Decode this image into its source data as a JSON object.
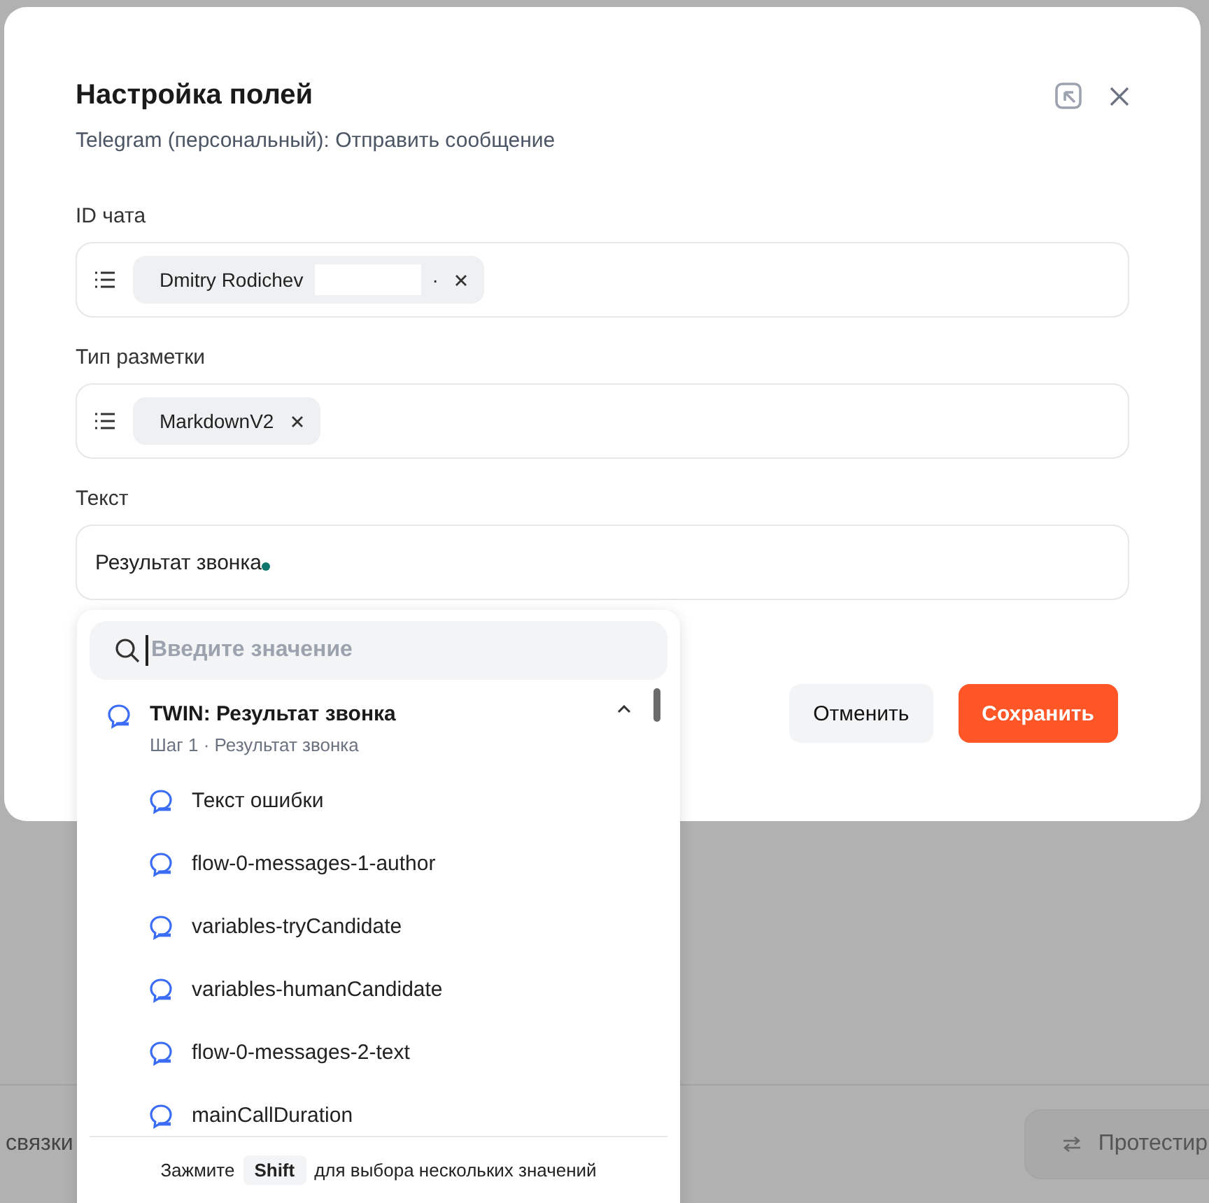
{
  "background_page": {
    "footer_text": "связки",
    "test_button": "Протестир"
  },
  "dialog": {
    "title": "Настройка полей",
    "subtitle": "Telegram (персональный): Отправить сообщение",
    "fields": [
      {
        "kind": "chips",
        "label": "ID чата",
        "chips": [
          {
            "label": "Dmitry Rodichev",
            "redacted": true,
            "suffix": "·"
          }
        ]
      },
      {
        "kind": "chips",
        "label": "Тип разметки",
        "chips": [
          {
            "label": "MarkdownV2",
            "redacted": false
          }
        ]
      },
      {
        "kind": "text",
        "label": "Текст",
        "value": "Результат звонка",
        "focused": true
      }
    ],
    "buttons": [
      {
        "label": "Отменить",
        "primary": false
      },
      {
        "label": "Сохранить",
        "primary": true
      }
    ]
  },
  "dropdown": {
    "search_placeholder": "Введите значение",
    "group": {
      "title": "TWIN: Результат звонка",
      "subtitle": "Шаг 1 · Результат звонка",
      "expanded": true
    },
    "items": [
      {
        "label": "Текст ошибки"
      },
      {
        "label": "flow-0-messages-1-author"
      },
      {
        "label": "variables-tryCandidate"
      },
      {
        "label": "variables-humanCandidate"
      },
      {
        "label": "flow-0-messages-2-text"
      },
      {
        "label": "mainCallDuration"
      }
    ],
    "hint_before": "Зажмите",
    "hint_key": "Shift",
    "hint_after": "для выбора нескольких значений"
  }
}
